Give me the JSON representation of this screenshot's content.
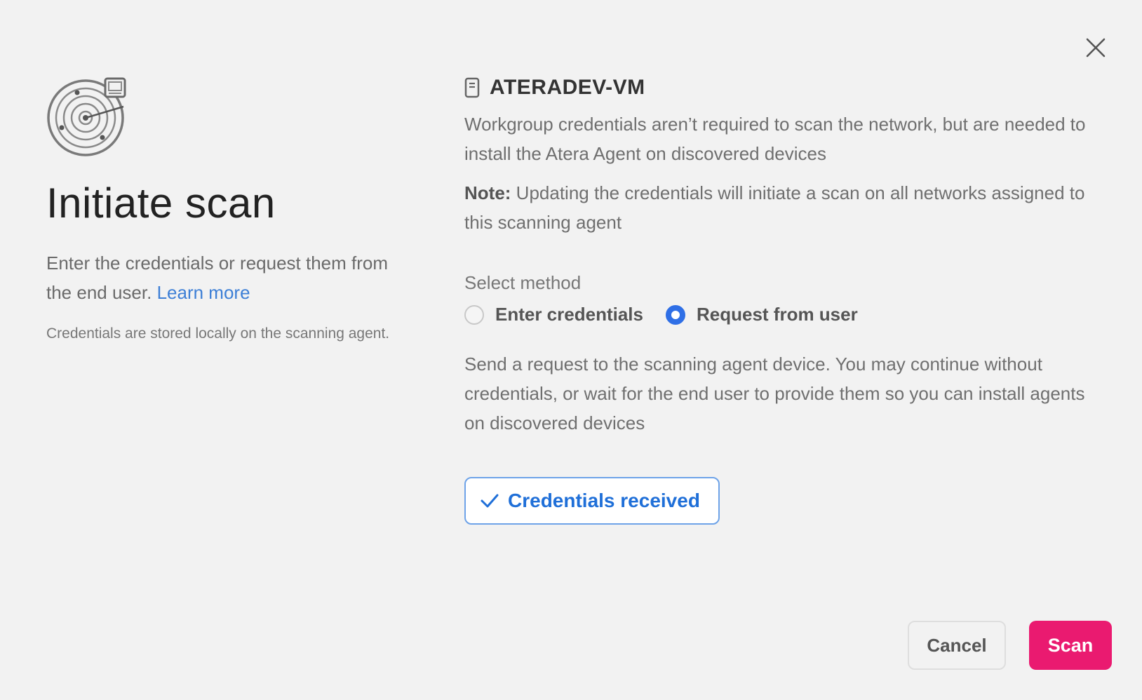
{
  "dialog": {
    "title": "Initiate scan",
    "intro_text": "Enter the credentials or request them from the end user.",
    "learn_more_label": "Learn more",
    "stored_note": "Credentials are stored locally on the scanning agent.",
    "close_icon": "close-icon",
    "illustration_icon": "radar-icon"
  },
  "device": {
    "icon": "server-icon",
    "name": "ATERADEV-VM",
    "description": "Workgroup credentials aren’t required to scan the network, but are needed to install the Atera Agent on discovered devices",
    "note_label": "Note:",
    "note_text": "Updating the credentials will initiate a scan on all networks assigned to this scanning agent"
  },
  "method": {
    "label": "Select method",
    "options": [
      {
        "label": "Enter credentials",
        "selected": false
      },
      {
        "label": "Request from user",
        "selected": true
      }
    ],
    "request_description": "Send a request to the scanning agent device. You may continue without credentials, or wait for the end user to provide them so you can install agents on discovered devices",
    "received_button_label": "Credentials received",
    "received_icon": "checkmark-icon"
  },
  "footer": {
    "cancel_label": "Cancel",
    "scan_label": "Scan"
  },
  "colors": {
    "accent_blue": "#2f6fe6",
    "link_blue": "#3d7fd6",
    "scan_pink": "#ea1a70",
    "background": "#f2f2f2"
  }
}
